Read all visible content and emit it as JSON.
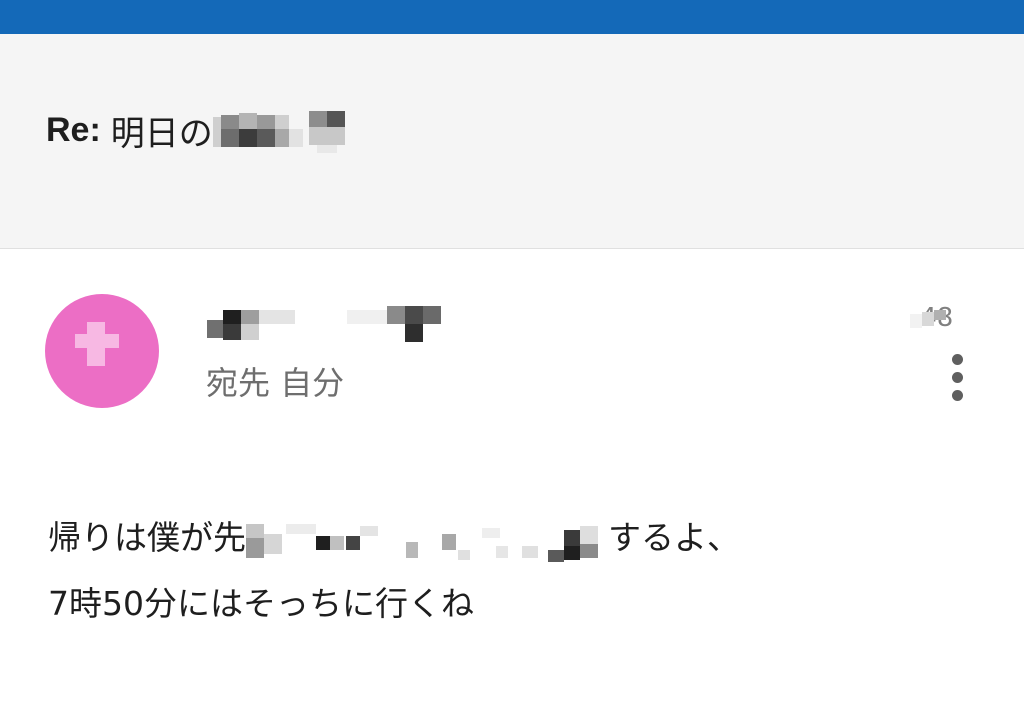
{
  "header": {
    "accent_color": "#1469b8"
  },
  "subject": {
    "prefix": "Re:",
    "visible_text": "明日の"
  },
  "message": {
    "avatar_color": "#ec6ec5",
    "recipients_label": "宛先 自分",
    "time_fragment": ".48",
    "more_icon": "more-vertical-icon",
    "body_line1_start": "帰りは僕が先",
    "body_line1_end": "するよ、",
    "body_line2": "7時50分にはそっちに行くね"
  }
}
